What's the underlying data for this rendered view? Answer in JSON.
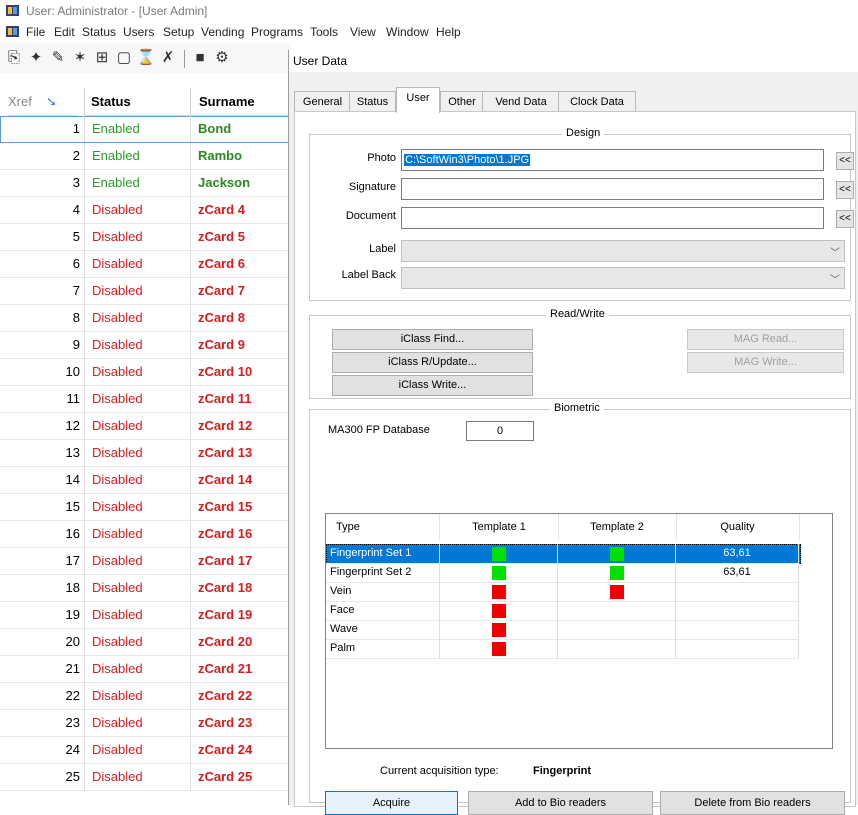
{
  "main_window": {
    "title": "User: Administrator - [User Admin]",
    "menu": [
      "File",
      "Edit",
      "Status",
      "Users",
      "Setup",
      "Vending",
      "Programs",
      "Tools",
      "View",
      "Window",
      "Help"
    ],
    "grid": {
      "headers": {
        "xref": "Xref",
        "status": "Status",
        "surname": "Surname"
      },
      "rows": [
        {
          "xref": "1",
          "status": "Enabled",
          "surname": "Bond"
        },
        {
          "xref": "2",
          "status": "Enabled",
          "surname": "Rambo"
        },
        {
          "xref": "3",
          "status": "Enabled",
          "surname": "Jackson"
        },
        {
          "xref": "4",
          "status": "Disabled",
          "surname": "zCard 4"
        },
        {
          "xref": "5",
          "status": "Disabled",
          "surname": "zCard 5"
        },
        {
          "xref": "6",
          "status": "Disabled",
          "surname": "zCard 6"
        },
        {
          "xref": "7",
          "status": "Disabled",
          "surname": "zCard 7"
        },
        {
          "xref": "8",
          "status": "Disabled",
          "surname": "zCard 8"
        },
        {
          "xref": "9",
          "status": "Disabled",
          "surname": "zCard 9"
        },
        {
          "xref": "10",
          "status": "Disabled",
          "surname": "zCard 10"
        },
        {
          "xref": "11",
          "status": "Disabled",
          "surname": "zCard 11"
        },
        {
          "xref": "12",
          "status": "Disabled",
          "surname": "zCard 12"
        },
        {
          "xref": "13",
          "status": "Disabled",
          "surname": "zCard 13"
        },
        {
          "xref": "14",
          "status": "Disabled",
          "surname": "zCard 14"
        },
        {
          "xref": "15",
          "status": "Disabled",
          "surname": "zCard 15"
        },
        {
          "xref": "16",
          "status": "Disabled",
          "surname": "zCard 16"
        },
        {
          "xref": "17",
          "status": "Disabled",
          "surname": "zCard 17"
        },
        {
          "xref": "18",
          "status": "Disabled",
          "surname": "zCard 18"
        },
        {
          "xref": "19",
          "status": "Disabled",
          "surname": "zCard 19"
        },
        {
          "xref": "20",
          "status": "Disabled",
          "surname": "zCard 20"
        },
        {
          "xref": "21",
          "status": "Disabled",
          "surname": "zCard 21"
        },
        {
          "xref": "22",
          "status": "Disabled",
          "surname": "zCard 22"
        },
        {
          "xref": "23",
          "status": "Disabled",
          "surname": "zCard 23"
        },
        {
          "xref": "24",
          "status": "Disabled",
          "surname": "zCard 24"
        },
        {
          "xref": "25",
          "status": "Disabled",
          "surname": "zCard 25"
        }
      ],
      "enabled_color": "#2a9c2a",
      "disabled_color": "#d21f1f"
    }
  },
  "dialog": {
    "title": "User Data",
    "tabs": [
      "General",
      "Status",
      "User",
      "Other",
      "Vend Data",
      "Clock Data"
    ],
    "active_tab": "User",
    "design": {
      "title": "Design",
      "photo_label": "Photo",
      "photo_value": "C:\\SoftWin3\\Photo\\1.JPG",
      "signature_label": "Signature",
      "signature_value": "",
      "document_label": "Document",
      "document_value": "",
      "browse_label": "<<",
      "label_label": "Label",
      "label_back_label": "Label Back"
    },
    "read_write": {
      "title": "Read/Write",
      "iclass_find": "iClass Find...",
      "iclass_update": "iClass R/Update...",
      "iclass_write": "iClass Write...",
      "mag_read": "MAG Read...",
      "mag_write": "MAG Write..."
    },
    "biometric": {
      "title": "Biometric",
      "db_label": "MA300 FP Database",
      "db_value": "0",
      "columns": [
        "Type",
        "Template 1",
        "Template 2",
        "Quality"
      ],
      "rows": [
        {
          "type": "Fingerprint Set 1",
          "t1": "green",
          "t2": "green",
          "quality": "63,61"
        },
        {
          "type": "Fingerprint Set 2",
          "t1": "green",
          "t2": "green",
          "quality": "63,61"
        },
        {
          "type": "Vein",
          "t1": "red",
          "t2": "red",
          "quality": ""
        },
        {
          "type": "Face",
          "t1": "red",
          "t2": "",
          "quality": ""
        },
        {
          "type": "Wave",
          "t1": "red",
          "t2": "",
          "quality": ""
        },
        {
          "type": "Palm",
          "t1": "red",
          "t2": "",
          "quality": ""
        }
      ],
      "acq_label": "Current acquisition type:",
      "acq_value": "Fingerprint",
      "acquire_btn": "Acquire",
      "add_btn": "Add to Bio readers",
      "delete_btn": "Delete from Bio readers"
    }
  }
}
